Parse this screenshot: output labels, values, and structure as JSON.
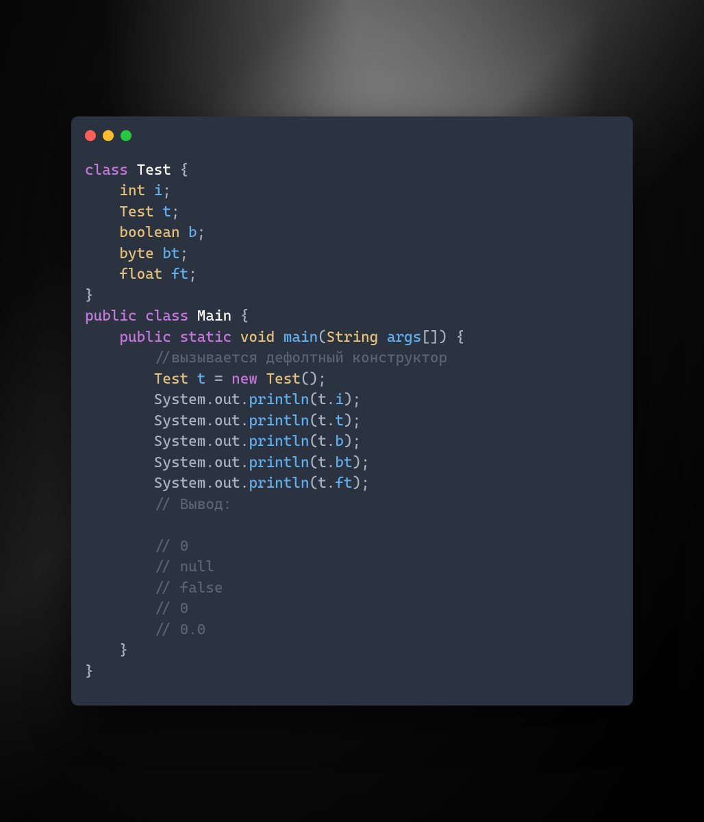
{
  "colors": {
    "bg": "#2b3340",
    "red": "#ff5f57",
    "yellow": "#febc2e",
    "green": "#28c840"
  },
  "code": {
    "l1_class": "class",
    "l1_name": "Test",
    "l1_brace": " {",
    "l2_type": "int",
    "l2_var": " i",
    "l2_end": ";",
    "l3_type": "Test",
    "l3_var": " t",
    "l3_end": ";",
    "l4_type": "boolean",
    "l4_var": " b",
    "l4_end": ";",
    "l5_type": "byte",
    "l5_var": " bt",
    "l5_end": ";",
    "l6_type": "float",
    "l6_var": " ft",
    "l6_end": ";",
    "l7": "}",
    "l8_public": "public",
    "l8_class": " class",
    "l8_name": " Main",
    "l8_brace": " {",
    "l9_public": "public",
    "l9_static": " static",
    "l9_void": " void",
    "l9_main": " main",
    "l9_p1": "(",
    "l9_string": "String",
    "l9_args": " args",
    "l9_brackets": "[]",
    "l9_p2": ")",
    "l9_brace": " {",
    "l10": "//вызывается дефолтный конструктор",
    "l11_type": "Test",
    "l11_var": " t",
    "l11_eq": " = ",
    "l11_new": "new",
    "l11_ctor": " Test",
    "l11_call": "();",
    "l12_sys": "System",
    "l12_d1": ".",
    "l12_out": "out",
    "l12_d2": ".",
    "l12_fn": "println",
    "l12_p1": "(",
    "l12_t": "t",
    "l12_d3": ".",
    "l12_f": "i",
    "l12_end": ");",
    "l13_sys": "System",
    "l13_d1": ".",
    "l13_out": "out",
    "l13_d2": ".",
    "l13_fn": "println",
    "l13_p1": "(",
    "l13_t": "t",
    "l13_d3": ".",
    "l13_f": "t",
    "l13_end": ");",
    "l14_sys": "System",
    "l14_d1": ".",
    "l14_out": "out",
    "l14_d2": ".",
    "l14_fn": "println",
    "l14_p1": "(",
    "l14_t": "t",
    "l14_d3": ".",
    "l14_f": "b",
    "l14_end": ");",
    "l15_sys": "System",
    "l15_d1": ".",
    "l15_out": "out",
    "l15_d2": ".",
    "l15_fn": "println",
    "l15_p1": "(",
    "l15_t": "t",
    "l15_d3": ".",
    "l15_f": "bt",
    "l15_end": ");",
    "l16_sys": "System",
    "l16_d1": ".",
    "l16_out": "out",
    "l16_d2": ".",
    "l16_fn": "println",
    "l16_p1": "(",
    "l16_t": "t",
    "l16_d3": ".",
    "l16_f": "ft",
    "l16_end": ");",
    "l17": "// Вывод:",
    "l18": "",
    "l19": "// 0",
    "l20": "// null",
    "l21": "// false",
    "l22": "// 0",
    "l23": "// 0.0",
    "l24": "    }",
    "l25": "}"
  }
}
